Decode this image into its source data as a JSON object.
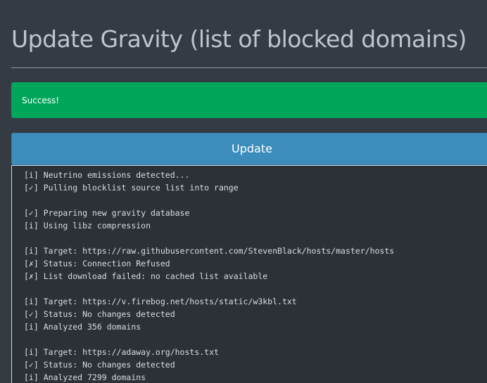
{
  "page": {
    "title": "Update Gravity (list of blocked domains)"
  },
  "alert": {
    "message": "Success!",
    "color": "#00a65a"
  },
  "update_button": {
    "label": "Update",
    "color": "#3c8dbc"
  },
  "output": {
    "lines": [
      "[i] Neutrino emissions detected...",
      "[✓] Pulling blocklist source list into range",
      "",
      "[✓] Preparing new gravity database",
      "[i] Using libz compression",
      "",
      "[i] Target: https://raw.githubusercontent.com/StevenBlack/hosts/master/hosts",
      "[✗] Status: Connection Refused",
      "[✗] List download failed: no cached list available",
      "",
      "[i] Target: https://v.firebog.net/hosts/static/w3kbl.txt",
      "[✓] Status: No changes detected",
      "[i] Analyzed 356 domains",
      "",
      "[i] Target: https://adaway.org/hosts.txt",
      "[✓] Status: No changes detected",
      "[i] Analyzed 7299 domains"
    ]
  }
}
